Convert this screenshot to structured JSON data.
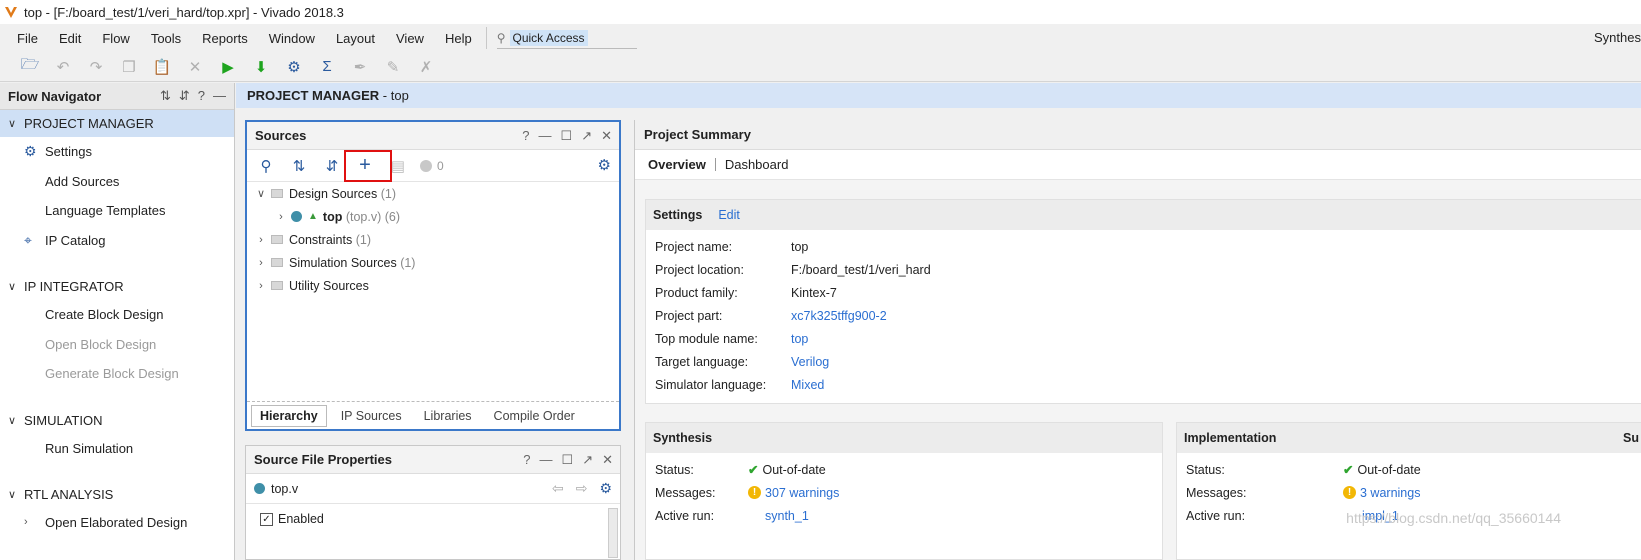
{
  "window": {
    "title": "top - [F:/board_test/1/veri_hard/top.xpr] - Vivado 2018.3"
  },
  "menu": {
    "items": [
      "File",
      "Edit",
      "Flow",
      "Tools",
      "Reports",
      "Window",
      "Layout",
      "View",
      "Help"
    ],
    "quick_access": "Quick Access",
    "right_label": "Synthes"
  },
  "flow_navigator": {
    "title": "Flow Navigator",
    "sections": [
      {
        "label": "PROJECT MANAGER",
        "items": [
          "Settings",
          "Add Sources",
          "Language Templates",
          "IP Catalog"
        ]
      },
      {
        "label": "IP INTEGRATOR",
        "items": [
          "Create Block Design",
          "Open Block Design",
          "Generate Block Design"
        ]
      },
      {
        "label": "SIMULATION",
        "items": [
          "Run Simulation"
        ]
      },
      {
        "label": "RTL ANALYSIS",
        "items": [
          "Open Elaborated Design"
        ]
      }
    ]
  },
  "project_manager": {
    "header_bold": "PROJECT MANAGER",
    "header_rest": " - top"
  },
  "sources": {
    "title": "Sources",
    "count": "0",
    "tree": [
      {
        "label": "Design Sources",
        "count": "(1)"
      },
      {
        "label": "top",
        "detail": "(top.v)",
        "count": "(6)"
      },
      {
        "label": "Constraints",
        "count": "(1)"
      },
      {
        "label": "Simulation Sources",
        "count": "(1)"
      },
      {
        "label": "Utility Sources",
        "count": ""
      }
    ],
    "tabs": [
      "Hierarchy",
      "IP Sources",
      "Libraries",
      "Compile Order"
    ]
  },
  "source_file_properties": {
    "title": "Source File Properties",
    "file": "top.v",
    "enabled_label": "Enabled"
  },
  "project_summary": {
    "title": "Project Summary",
    "tabs": [
      "Overview",
      "Dashboard"
    ],
    "settings": {
      "title": "Settings",
      "edit": "Edit",
      "rows": [
        {
          "key": "Project name:",
          "value": "top",
          "link": false
        },
        {
          "key": "Project location:",
          "value": "F:/board_test/1/veri_hard",
          "link": false
        },
        {
          "key": "Product family:",
          "value": "Kintex-7",
          "link": false
        },
        {
          "key": "Project part:",
          "value": "xc7k325tffg900-2",
          "link": true
        },
        {
          "key": "Top module name:",
          "value": "top",
          "link": true
        },
        {
          "key": "Target language:",
          "value": "Verilog",
          "link": true
        },
        {
          "key": "Simulator language:",
          "value": "Mixed",
          "link": true
        }
      ]
    },
    "synthesis": {
      "title": "Synthesis",
      "status_key": "Status:",
      "status": "Out-of-date",
      "messages_key": "Messages:",
      "messages": "307 warnings",
      "run_key": "Active run:",
      "run": "synth_1"
    },
    "implementation": {
      "title": "Implementation",
      "status_key": "Status:",
      "status": "Out-of-date",
      "messages_key": "Messages:",
      "messages": "3 warnings",
      "run_key": "Active run:",
      "run": "impl_1"
    },
    "cut_header": "Su"
  },
  "watermark": "https://blog.csdn.net/qq_35660144"
}
